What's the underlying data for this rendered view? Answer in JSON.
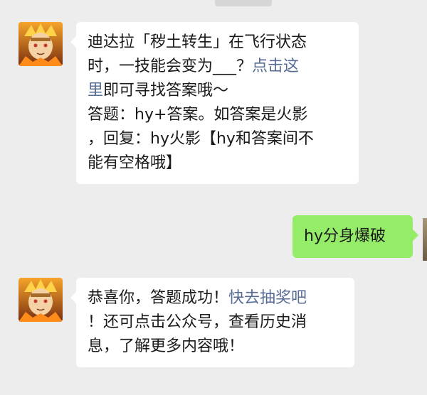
{
  "messages": [
    {
      "sender": "official-account",
      "lines": [
        [
          "迪达拉「秽土转生」在飞行状态"
        ],
        [
          "时，一技能会变为___？",
          {
            "link": "点击这"
          }
        ],
        [
          {
            "link": "里"
          },
          "即可寻找答案哦～"
        ],
        [
          "答题：hy+答案。如答案是火影"
        ],
        [
          "，回复：hy火影【hy和答案间不"
        ],
        [
          "能有空格哦】"
        ]
      ]
    },
    {
      "sender": "user",
      "text": "hy分身爆破"
    },
    {
      "sender": "official-account",
      "lines": [
        [
          "恭喜你，答题成功！",
          {
            "link": "快去抽奖吧"
          }
        ],
        [
          "！还可点击公众号，查看历史消"
        ],
        [
          "息，了解更多内容哦！"
        ]
      ]
    }
  ],
  "colors": {
    "background": "#ededed",
    "bubble_incoming": "#ffffff",
    "bubble_outgoing": "#95ec69",
    "link": "#576b95",
    "text": "#1a1a1a"
  },
  "icons": {
    "sender_avatar": "anime-character-avatar-icon",
    "user_avatar": "user-avatar-icon"
  }
}
